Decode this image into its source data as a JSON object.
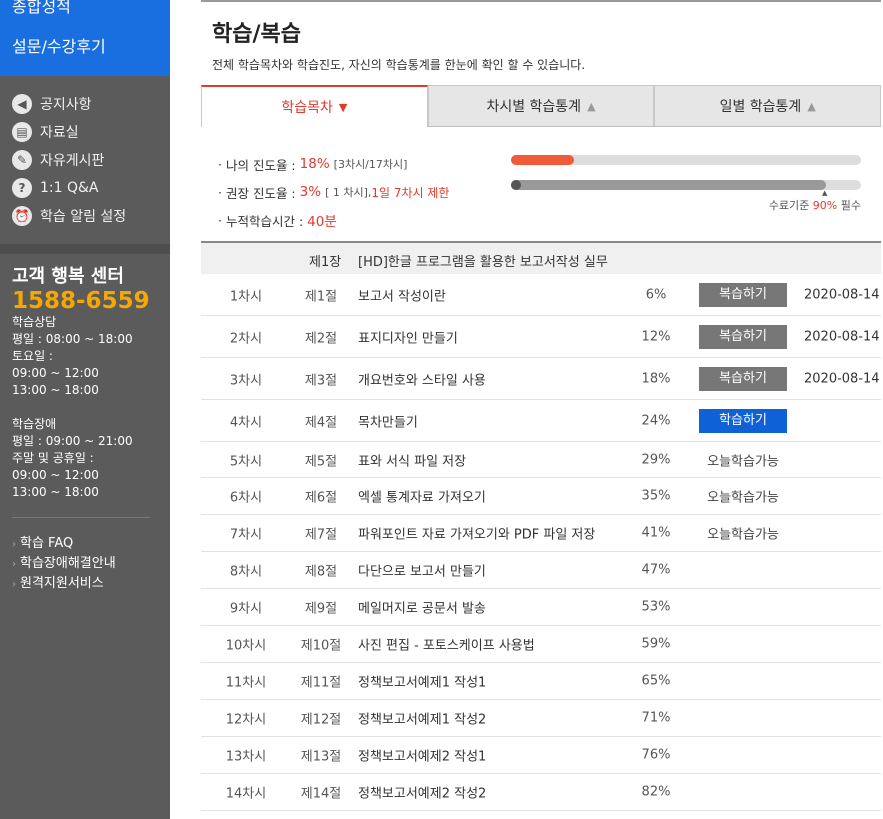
{
  "sidebar": {
    "top_items": [
      "종합성적",
      "설문/수강후기"
    ],
    "menu": [
      {
        "icon": "speaker-icon",
        "label": "공지사항"
      },
      {
        "icon": "clipboard-icon",
        "label": "자료실"
      },
      {
        "icon": "edit-icon",
        "label": "자유게시판"
      },
      {
        "icon": "question-icon",
        "label": "1:1 Q&A"
      },
      {
        "icon": "alarm-icon",
        "label": "학습 알림 설정"
      }
    ],
    "cs": {
      "title": "고객 행복 센터",
      "phone": "1588-6559",
      "lines1": [
        "학습상담",
        "평일 : 08:00 ~ 18:00",
        "토요일 :",
        "09:00 ~ 12:00",
        "13:00 ~ 18:00"
      ],
      "lines2": [
        "학습장애",
        "평일 : 09:00 ~ 21:00",
        "주말 및 공휴일 :",
        "09:00 ~ 12:00",
        "13:00 ~ 18:00"
      ]
    },
    "links": [
      "학습 FAQ",
      "학습장애해결안내",
      "원격지원서비스"
    ]
  },
  "header": {
    "title": "학습/복습",
    "subtitle": "전체 학습목차와 학습진도, 자신의 학습통계를 한눈에 확인 할 수 있습니다."
  },
  "tabs": [
    {
      "label": "학습목차",
      "arrow": "▼"
    },
    {
      "label": "차시별 학습통계",
      "arrow": "▲"
    },
    {
      "label": "일별 학습통계",
      "arrow": "▲"
    }
  ],
  "stats": {
    "my_progress_label": "나의 진도율 : ",
    "my_progress_value": "18",
    "my_progress_unit": "%",
    "my_progress_detail": "[3차시/17차시]",
    "my_progress_fraction": 0.18,
    "recommended_label": "권장 진도율 : ",
    "recommended_value": "3",
    "recommended_unit": "%",
    "recommended_detail": "[ 1 차시],",
    "recommended_limit": "1일 7차시 제한",
    "recommended_fraction": 0.03,
    "cumulative_label": "누적학습시간 : ",
    "cumulative_value": "40",
    "cumulative_unit": "분",
    "completion_prefix": "수료기준 ",
    "completion_value": "90%",
    "completion_suffix": " 필수",
    "completion_fraction": 0.9
  },
  "chapter": {
    "no": "제1장",
    "title": "[HD]한글 프로그램을 활용한 보고서작성 실무"
  },
  "lessons": [
    {
      "no": "1차시",
      "sec": "제1절",
      "title": "보고서 작성이란",
      "pct": "6%",
      "action": "복습하기",
      "action_type": "review",
      "date": "2020-08-14"
    },
    {
      "no": "2차시",
      "sec": "제2절",
      "title": "표지디자인 만들기",
      "pct": "12%",
      "action": "복습하기",
      "action_type": "review",
      "date": "2020-08-14"
    },
    {
      "no": "3차시",
      "sec": "제3절",
      "title": "개요번호와 스타일 사용",
      "pct": "18%",
      "action": "복습하기",
      "action_type": "review",
      "date": "2020-08-14"
    },
    {
      "no": "4차시",
      "sec": "제4절",
      "title": "목차만들기",
      "pct": "24%",
      "action": "학습하기",
      "action_type": "study",
      "date": ""
    },
    {
      "no": "5차시",
      "sec": "제5절",
      "title": "표와 서식 파일 저장",
      "pct": "29%",
      "action": "오늘학습가능",
      "action_type": "text",
      "date": ""
    },
    {
      "no": "6차시",
      "sec": "제6절",
      "title": "엑셀 통계자료 가져오기",
      "pct": "35%",
      "action": "오늘학습가능",
      "action_type": "text",
      "date": ""
    },
    {
      "no": "7차시",
      "sec": "제7절",
      "title": "파워포인트 자료 가져오기와 PDF 파일 저장",
      "pct": "41%",
      "action": "오늘학습가능",
      "action_type": "text",
      "date": ""
    },
    {
      "no": "8차시",
      "sec": "제8절",
      "title": "다단으로 보고서 만들기",
      "pct": "47%",
      "action": "",
      "action_type": "none",
      "date": ""
    },
    {
      "no": "9차시",
      "sec": "제9절",
      "title": "메일머지로 공문서 발송",
      "pct": "53%",
      "action": "",
      "action_type": "none",
      "date": ""
    },
    {
      "no": "10차시",
      "sec": "제10절",
      "title": "사진 편집 - 포토스케이프 사용법",
      "pct": "59%",
      "action": "",
      "action_type": "none",
      "date": ""
    },
    {
      "no": "11차시",
      "sec": "제11절",
      "title": "정책보고서예제1 작성1",
      "pct": "65%",
      "action": "",
      "action_type": "none",
      "date": ""
    },
    {
      "no": "12차시",
      "sec": "제12절",
      "title": "정책보고서예제1 작성2",
      "pct": "71%",
      "action": "",
      "action_type": "none",
      "date": ""
    },
    {
      "no": "13차시",
      "sec": "제13절",
      "title": "정책보고서예제2 작성1",
      "pct": "76%",
      "action": "",
      "action_type": "none",
      "date": ""
    },
    {
      "no": "14차시",
      "sec": "제14절",
      "title": "정책보고서예제2 작성2",
      "pct": "82%",
      "action": "",
      "action_type": "none",
      "date": ""
    }
  ],
  "colors": {
    "accent_red": "#e23a2e",
    "brand_blue": "#1a6fe0",
    "study_blue": "#0e62d6",
    "phone_orange": "#f6a800"
  }
}
